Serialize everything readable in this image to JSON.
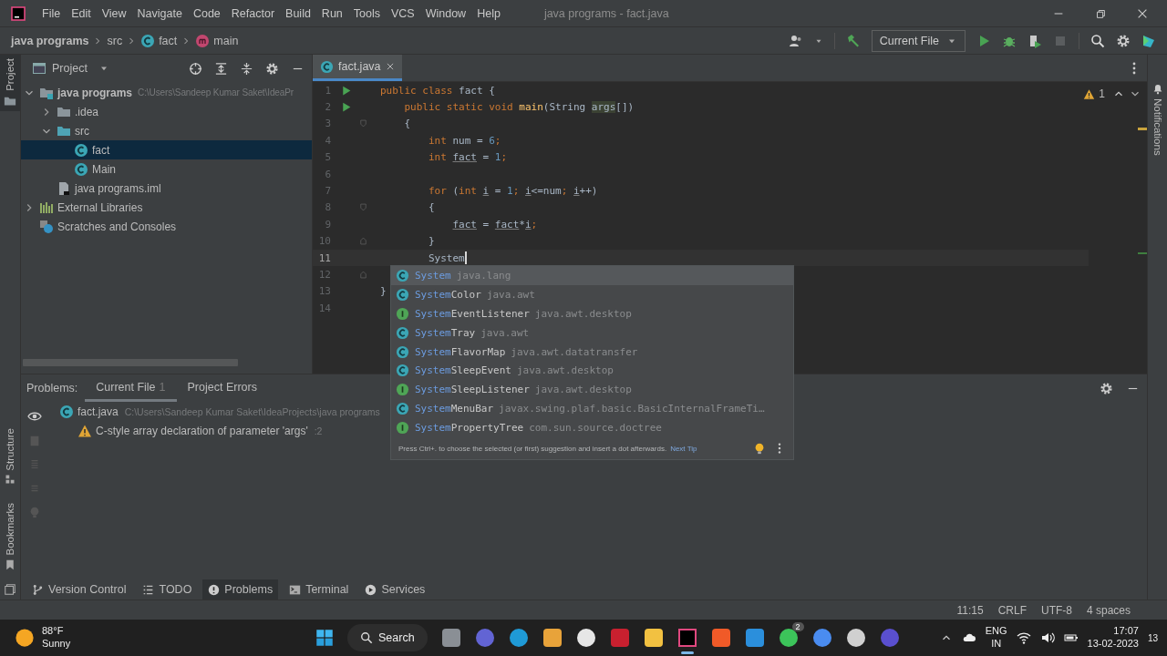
{
  "window": {
    "title": "java programs - fact.java",
    "menu": [
      "File",
      "Edit",
      "View",
      "Navigate",
      "Code",
      "Refactor",
      "Build",
      "Run",
      "Tools",
      "VCS",
      "Window",
      "Help"
    ]
  },
  "breadcrumbs": [
    {
      "label": "java programs",
      "kind": "project"
    },
    {
      "label": "src",
      "kind": "folder"
    },
    {
      "label": "fact",
      "kind": "class"
    },
    {
      "label": "main",
      "kind": "method"
    }
  ],
  "run_config": {
    "label": "Current File"
  },
  "left_stripe": {
    "top": [
      {
        "label": "Project",
        "selected": true
      }
    ],
    "bottom": [
      {
        "label": "Structure",
        "kind": "structure"
      },
      {
        "label": "Bookmarks",
        "kind": "bookmark"
      }
    ]
  },
  "right_stripe": [
    {
      "label": "Notifications"
    }
  ],
  "project_panel": {
    "title": "Project",
    "tree": [
      {
        "label": "java programs",
        "kind": "module",
        "path": "C:\\Users\\Sandeep Kumar Saket\\IdeaPr",
        "expanded": true,
        "selected": false,
        "children": [
          {
            "label": ".idea",
            "kind": "folder",
            "expanded": false,
            "selected": false
          },
          {
            "label": "src",
            "kind": "source",
            "expanded": true,
            "selected": false,
            "children": [
              {
                "label": "fact",
                "kind": "class",
                "selected": true
              },
              {
                "label": "Main",
                "kind": "class",
                "selected": false
              }
            ]
          },
          {
            "label": "java programs.iml",
            "kind": "file",
            "selected": false
          }
        ]
      },
      {
        "label": "External Libraries",
        "kind": "libraries",
        "expanded": false,
        "selected": false
      },
      {
        "label": "Scratches and Consoles",
        "kind": "scratches",
        "selected": false
      }
    ]
  },
  "editor": {
    "tabs": [
      {
        "label": "fact.java",
        "selected": true
      }
    ],
    "warnings": "1",
    "lines": [
      {
        "number": "1",
        "run": true,
        "tokens": [
          {
            "text": "public class ",
            "kind": "kw"
          },
          {
            "text": "fact {",
            "kind": "plain"
          }
        ]
      },
      {
        "number": "2",
        "run": true,
        "tokens": [
          {
            "text": "    public static void ",
            "kind": "kw"
          },
          {
            "text": "main",
            "kind": "method"
          },
          {
            "text": "(String ",
            "kind": "plain"
          },
          {
            "text": "args",
            "kind": "param"
          },
          {
            "text": "[])",
            "kind": "plain"
          }
        ]
      },
      {
        "number": "3",
        "fold_start": true,
        "tokens": [
          {
            "text": "    {",
            "kind": "plain"
          }
        ]
      },
      {
        "number": "4",
        "tokens": [
          {
            "text": "        int ",
            "kind": "kw"
          },
          {
            "text": "num = ",
            "kind": "plain"
          },
          {
            "text": "6",
            "kind": "num"
          },
          {
            "text": ";",
            "kind": "kw"
          }
        ]
      },
      {
        "number": "5",
        "tokens": [
          {
            "text": "        int ",
            "kind": "kw"
          },
          {
            "text": "fact",
            "kind": "var"
          },
          {
            "text": " = ",
            "kind": "plain"
          },
          {
            "text": "1",
            "kind": "num"
          },
          {
            "text": ";",
            "kind": "kw"
          }
        ]
      },
      {
        "number": "6"
      },
      {
        "number": "7",
        "tokens": [
          {
            "text": "        for ",
            "kind": "kw"
          },
          {
            "text": "(",
            "kind": "plain"
          },
          {
            "text": "int ",
            "kind": "kw"
          },
          {
            "text": "i",
            "kind": "var"
          },
          {
            "text": " = ",
            "kind": "plain"
          },
          {
            "text": "1",
            "kind": "num"
          },
          {
            "text": "; ",
            "kind": "kw"
          },
          {
            "text": "i",
            "kind": "var"
          },
          {
            "text": "<=num",
            "kind": "plain"
          },
          {
            "text": "; ",
            "kind": "kw"
          },
          {
            "text": "i",
            "kind": "var"
          },
          {
            "text": "++)",
            "kind": "plain"
          }
        ]
      },
      {
        "number": "8",
        "fold_start": true,
        "tokens": [
          {
            "text": "        {",
            "kind": "plain"
          }
        ]
      },
      {
        "number": "9",
        "tokens": [
          {
            "text": "            fact",
            "kind": "var"
          },
          {
            "text": " = ",
            "kind": "plain"
          },
          {
            "text": "fact",
            "kind": "var"
          },
          {
            "text": "*",
            "kind": "plain"
          },
          {
            "text": "i",
            "kind": "var"
          },
          {
            "text": ";",
            "kind": "kw"
          }
        ]
      },
      {
        "number": "10",
        "fold_end": true,
        "tokens": [
          {
            "text": "        }",
            "kind": "plain"
          }
        ]
      },
      {
        "number": "11",
        "current": true,
        "caret": true,
        "tokens": [
          {
            "text": "        System",
            "kind": "plain"
          }
        ]
      },
      {
        "number": "12",
        "fold_end": true
      },
      {
        "number": "13",
        "tokens": [
          {
            "text": "}",
            "kind": "plain"
          }
        ]
      },
      {
        "number": "14"
      }
    ],
    "completion": {
      "items": [
        {
          "match": "System",
          "package": "java.lang",
          "kind": "class",
          "selected": true
        },
        {
          "match": "System",
          "rest": "Color",
          "package": "java.awt",
          "kind": "class",
          "selected": false
        },
        {
          "match": "System",
          "rest": "EventListener",
          "package": "java.awt.desktop",
          "kind": "interface",
          "selected": false
        },
        {
          "match": "System",
          "rest": "Tray",
          "package": "java.awt",
          "kind": "class",
          "selected": false
        },
        {
          "match": "System",
          "rest": "FlavorMap",
          "package": "java.awt.datatransfer",
          "kind": "class",
          "selected": false
        },
        {
          "match": "System",
          "rest": "SleepEvent",
          "package": "java.awt.desktop",
          "kind": "class",
          "selected": false
        },
        {
          "match": "System",
          "rest": "SleepListener",
          "package": "java.awt.desktop",
          "kind": "interface",
          "selected": false
        },
        {
          "match": "System",
          "rest": "MenuBar",
          "package": "javax.swing.plaf.basic.BasicInternalFrameTi…",
          "kind": "class",
          "selected": false
        },
        {
          "match": "System",
          "rest": "PropertyTree",
          "package": "com.sun.source.doctree",
          "kind": "interface",
          "selected": false
        }
      ],
      "hint": "Press Ctrl+. to choose the selected (or first) suggestion and insert a dot afterwards.",
      "link": "Next Tip"
    }
  },
  "problems": {
    "label": "Problems:",
    "tabs": [
      {
        "label": "Current File",
        "count": "1",
        "selected": true
      },
      {
        "label": "Project Errors",
        "selected": false
      }
    ],
    "tree": [
      {
        "label": "fact.java",
        "kind": "class",
        "path": "C:\\Users\\Sandeep Kumar Saket\\IdeaProjects\\java programs",
        "children": [
          {
            "label": "C-style array declaration of parameter 'args'",
            "kind": "warning",
            "line": ":2"
          }
        ]
      }
    ]
  },
  "tool_windows": [
    {
      "label": "Version Control",
      "kind": "vcs",
      "selected": false
    },
    {
      "label": "TODO",
      "kind": "todo",
      "selected": false
    },
    {
      "label": "Problems",
      "kind": "problems",
      "selected": true
    },
    {
      "label": "Terminal",
      "kind": "terminal",
      "selected": false
    },
    {
      "label": "Services",
      "kind": "services",
      "selected": false
    }
  ],
  "status_bar": [
    "11:15",
    "CRLF",
    "UTF-8",
    "4 spaces"
  ],
  "taskbar": {
    "weather": {
      "temperature": "88°F",
      "condition": "Sunny"
    },
    "search": "Search",
    "apps": [
      {
        "kind": "square",
        "color": "#8a8f95",
        "selected": false
      },
      {
        "kind": "circle",
        "color": "#6264d4",
        "selected": false
      },
      {
        "kind": "circle",
        "color": "#1f9ad6",
        "selected": false
      },
      {
        "kind": "square",
        "color": "#e8a33a",
        "selected": false
      },
      {
        "kind": "circle",
        "color": "#e6e6e6",
        "selected": false
      },
      {
        "kind": "square",
        "color": "#c8202f",
        "selected": false
      },
      {
        "kind": "square",
        "color": "#f2c141",
        "selected": false
      },
      {
        "kind": "framed",
        "color": "#000000",
        "selected": true
      },
      {
        "kind": "square",
        "color": "#f05a28",
        "selected": false
      },
      {
        "kind": "square",
        "color": "#2b8fdc",
        "selected": false
      },
      {
        "kind": "circle",
        "color": "#3cc45a",
        "selected": false,
        "badge": "2"
      },
      {
        "kind": "circle",
        "color": "#4a8cf0",
        "selected": false
      },
      {
        "kind": "circle",
        "color": "#d0d0d0",
        "selected": false
      },
      {
        "kind": "circle",
        "color": "#5a4fcf",
        "selected": false
      }
    ],
    "language": "ENG",
    "region": "IN",
    "time": "17:07",
    "date": "13-02-2023",
    "notifications": "13"
  }
}
